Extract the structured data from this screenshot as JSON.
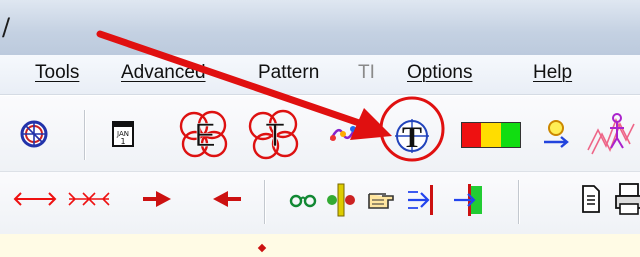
{
  "window": {
    "title_fragment": "/"
  },
  "menu": {
    "items": [
      {
        "label": "Tools",
        "enabled": true
      },
      {
        "label": "Advanced",
        "enabled": true
      },
      {
        "label": "Pattern",
        "enabled": true
      },
      {
        "label": "TI",
        "enabled": false
      },
      {
        "label": "Options",
        "enabled": true
      },
      {
        "label": "Help",
        "enabled": true
      }
    ]
  },
  "toolbar_top": {
    "buttons": [
      {
        "icon": "compass-globe-icon"
      },
      {
        "icon": "calendar-icon",
        "text": "JAN 1"
      },
      {
        "icon": "loop-letter-e-icon",
        "text": "E"
      },
      {
        "icon": "loop-letter-t-icon",
        "text": "T"
      },
      {
        "icon": "wave-dots-icon"
      },
      {
        "icon": "targeted-letter-t-icon",
        "text": "T",
        "highlighted": true
      },
      {
        "icon": "color-bar-icon",
        "colors": [
          "#ee1111",
          "#ffdd00",
          "#11dd11"
        ]
      },
      {
        "icon": "sun-arrow-icon"
      },
      {
        "icon": "stick-figure-icon"
      }
    ]
  },
  "toolbar_bottom": {
    "buttons": [
      {
        "icon": "double-arrow-out-icon"
      },
      {
        "icon": "arrows-converge-icon"
      },
      {
        "icon": "arrow-right-icon"
      },
      {
        "icon": "arrow-left-icon"
      },
      {
        "icon": "glasses-icon"
      },
      {
        "icon": "split-pillar-icon"
      },
      {
        "icon": "pointing-hand-icon"
      },
      {
        "icon": "arrow-to-bar-icon"
      },
      {
        "icon": "arrow-to-green-bar-icon"
      },
      {
        "icon": "document-icon"
      },
      {
        "icon": "printer-icon"
      }
    ]
  },
  "annotation": {
    "color": "#e01010",
    "kind": "arrow-and-circle"
  }
}
